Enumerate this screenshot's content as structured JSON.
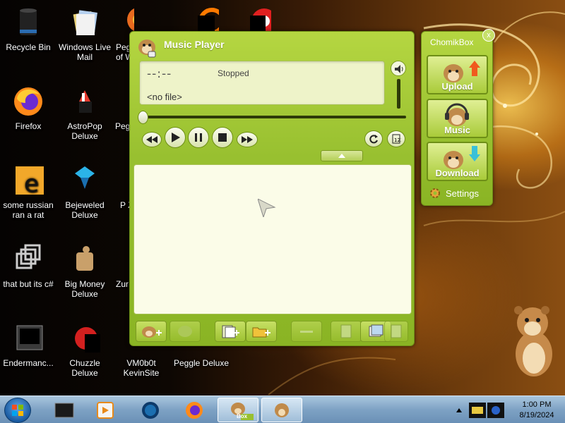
{
  "desktop_icons": [
    {
      "name": "recycle-bin",
      "label": "Recycle Bin"
    },
    {
      "name": "windows-live-mail",
      "label": "Windows Live Mail"
    },
    {
      "name": "peggle-nights",
      "label": "Peg of W"
    },
    {
      "name": "firefox",
      "label": "Firefox"
    },
    {
      "name": "astropop-deluxe",
      "label": "AstroPop Deluxe"
    },
    {
      "name": "peggle-2",
      "label": "Peg"
    },
    {
      "name": "some-russian",
      "label": "some russian ran a rat"
    },
    {
      "name": "bejeweled-deluxe",
      "label": "Bejeweled Deluxe"
    },
    {
      "name": "pz",
      "label": "P Z"
    },
    {
      "name": "that-but-its-c",
      "label": "that but its c#"
    },
    {
      "name": "big-money-deluxe",
      "label": "Big Money Deluxe"
    },
    {
      "name": "zuma",
      "label": "Zur"
    },
    {
      "name": "endermanc",
      "label": "Endermanc..."
    },
    {
      "name": "chuzzle-deluxe",
      "label": "Chuzzle Deluxe"
    },
    {
      "name": "vm0b0t",
      "label": "VM0b0t KevinSite"
    },
    {
      "name": "peggle-deluxe",
      "label": "Peggle Deluxe"
    }
  ],
  "player": {
    "title": "Music Player",
    "time": "--:--",
    "status": "Stopped",
    "file": "<no file>",
    "playback_position": 0
  },
  "chomikbox": {
    "title_prefix": "Chomik",
    "title_suffix": "Box",
    "upload": "Upload",
    "music": "Music",
    "download": "Download",
    "settings": "Settings",
    "close": "x"
  },
  "taskbar": {
    "time": "1:00 PM",
    "date": "8/19/2024",
    "box_label": "Box"
  },
  "colors": {
    "player_green": "#98c030",
    "display_bg": "#eef3c9",
    "playlist_bg": "#fbfce8",
    "taskbar": "#7ea2c4"
  }
}
